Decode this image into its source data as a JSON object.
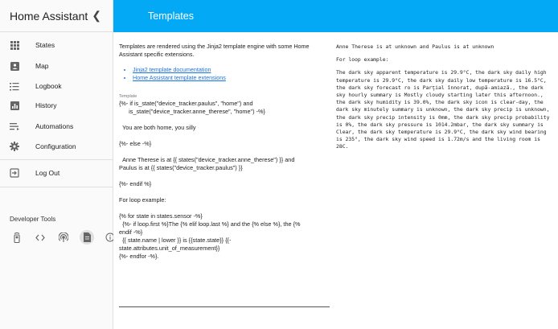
{
  "sidebar": {
    "title": "Home Assistant",
    "items": [
      {
        "label": "States",
        "icon": "grid-icon"
      },
      {
        "label": "Map",
        "icon": "map-icon"
      },
      {
        "label": "Logbook",
        "icon": "list-icon"
      },
      {
        "label": "History",
        "icon": "chart-icon"
      },
      {
        "label": "Automations",
        "icon": "automation-icon"
      },
      {
        "label": "Configuration",
        "icon": "gear-icon"
      }
    ],
    "logout_label": "Log Out",
    "dev_tools_title": "Developer Tools"
  },
  "header": {
    "title": "Templates"
  },
  "main": {
    "intro": "Templates are rendered using the Jinja2 template engine with some Home Assistant specific extensions.",
    "links": [
      "Jinja2 template documentation",
      "Home Assistant template extensions"
    ],
    "template_label": "Template",
    "template_text": "{%- if is_state(\"device_tracker.paulus\", \"home\") and\n      is_state(\"device_tracker.anne_therese\", \"home\") -%}\n\n  You are both home, you silly\n\n{%- else -%}\n\n  Anne Therese is at {{ states(\"device_tracker.anne_therese\") }} and\nPaulus is at {{ states(\"device_tracker.paulus\") }}\n\n{%- endif %}\n\nFor loop example:\n\n{% for state in states.sensor -%}\n  {%- if loop.first %}The {% elif loop.last %} and the {% else %}, the {%\nendif -%}\n  {{ state.name | lower }} is {{state.state}} {{-\nstate.attributes.unit_of_measurement}}\n{%- endfor -%}.",
    "result_lines": [
      "Anne Therese is at unknown and Paulus is at unknown",
      "For loop example:",
      "The dark sky apparent temperature is 29.9°C, the dark sky daily high temperature is 29.9°C, the dark sky daily low temperature is 16.5°C, the dark sky forecast ro is Parţial înnorat, după-amiază., the dark sky hourly summary is Mostly cloudy starting later this afternoon., the dark sky humidity is 39.0%, the dark sky icon is clear-day, the dark sky minutely summary is unknown, the dark sky precip is unknown, the dark sky precip intensity is 0mm, the dark sky precip probability is 0%, the dark sky pressure is 1014.2mbar, the dark sky summary is Clear, the dark sky temperature is 29.9°C, the dark sky wind bearing is 235°, the dark sky wind speed is 1.72m/s and the living room is 28C."
    ]
  }
}
